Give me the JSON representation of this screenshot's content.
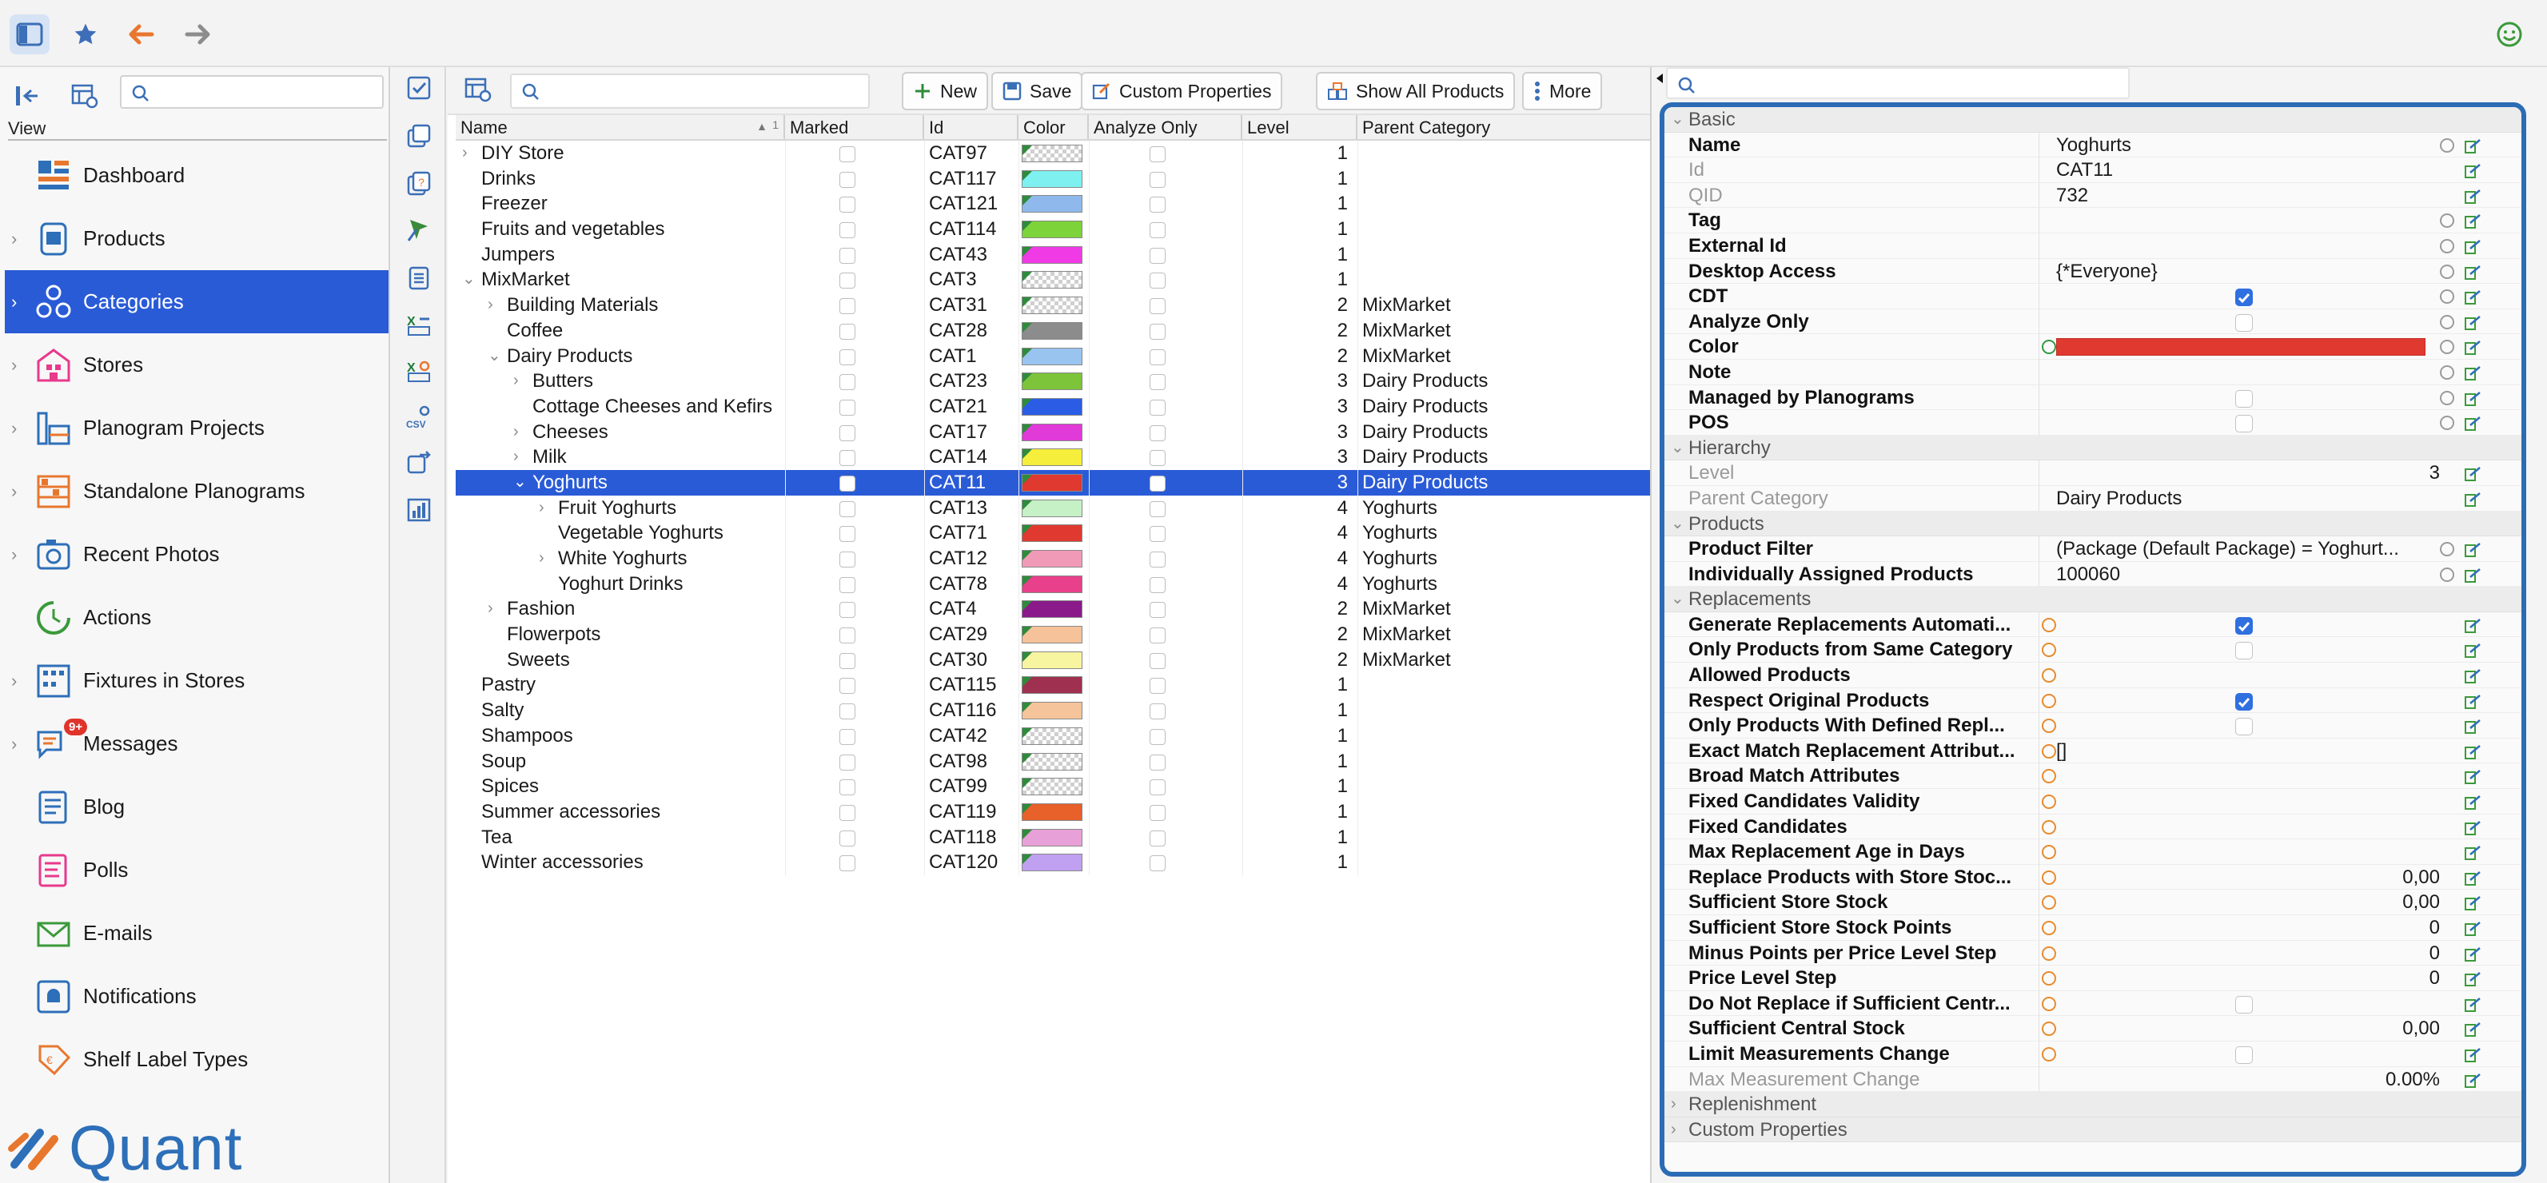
{
  "topbar": {
    "icons": [
      "sidebar-icon",
      "star-icon",
      "back-arrow-icon",
      "forward-arrow-icon",
      "smiley-icon"
    ]
  },
  "leftnav": {
    "search_placeholder": "",
    "view_label": "View",
    "items": [
      {
        "label": "Dashboard",
        "icon": "dashboard-icon",
        "chevron": false
      },
      {
        "label": "Products",
        "icon": "products-icon",
        "chevron": true
      },
      {
        "label": "Categories",
        "icon": "categories-icon",
        "chevron": true,
        "selected": true
      },
      {
        "label": "Stores",
        "icon": "stores-icon",
        "chevron": true
      },
      {
        "label": "Planogram Projects",
        "icon": "planogram-projects-icon",
        "chevron": true
      },
      {
        "label": "Standalone Planograms",
        "icon": "standalone-planograms-icon",
        "chevron": true
      },
      {
        "label": "Recent Photos",
        "icon": "camera-icon",
        "chevron": true
      },
      {
        "label": "Actions",
        "icon": "actions-icon",
        "chevron": false
      },
      {
        "label": "Fixtures in Stores",
        "icon": "fixtures-icon",
        "chevron": true
      },
      {
        "label": "Messages",
        "icon": "messages-icon",
        "chevron": true,
        "badge": "9+"
      },
      {
        "label": "Blog",
        "icon": "blog-icon",
        "chevron": false
      },
      {
        "label": "Polls",
        "icon": "polls-icon",
        "chevron": false
      },
      {
        "label": "E-mails",
        "icon": "email-icon",
        "chevron": false
      },
      {
        "label": "Notifications",
        "icon": "notifications-icon",
        "chevron": false
      },
      {
        "label": "Shelf Label Types",
        "icon": "shelf-label-icon",
        "chevron": false
      }
    ],
    "brand": "Quant"
  },
  "toolbar": {
    "search_placeholder": "",
    "new_label": "New",
    "save_label": "Save",
    "custom_properties_label": "Custom Properties",
    "show_all_products_label": "Show All Products",
    "more_label": "More"
  },
  "grid": {
    "columns": [
      "Name",
      "Marked",
      "Id",
      "Color",
      "Analyze Only",
      "Level",
      "Parent Category"
    ],
    "sort_indicator": "1",
    "rows": [
      {
        "name": "DIY Store",
        "indent": 0,
        "chev": "right",
        "id": "CAT97",
        "color": "checker",
        "level": "1",
        "parent": ""
      },
      {
        "name": "Drinks",
        "indent": 0,
        "chev": "",
        "id": "CAT117",
        "color": "#7ef0f0",
        "level": "1",
        "parent": ""
      },
      {
        "name": "Freezer",
        "indent": 0,
        "chev": "",
        "id": "CAT121",
        "color": "#8fb9ec",
        "level": "1",
        "parent": ""
      },
      {
        "name": "Fruits and vegetables",
        "indent": 0,
        "chev": "",
        "id": "CAT114",
        "color": "#7dd33a",
        "level": "1",
        "parent": ""
      },
      {
        "name": "Jumpers",
        "indent": 0,
        "chev": "",
        "id": "CAT43",
        "color": "#f03ae6",
        "level": "1",
        "parent": ""
      },
      {
        "name": "MixMarket",
        "indent": 0,
        "chev": "down",
        "id": "CAT3",
        "color": "checker",
        "level": "1",
        "parent": ""
      },
      {
        "name": "Building Materials",
        "indent": 1,
        "chev": "right",
        "id": "CAT31",
        "color": "checker",
        "level": "2",
        "parent": "MixMarket"
      },
      {
        "name": "Coffee",
        "indent": 1,
        "chev": "",
        "id": "CAT28",
        "color": "#8c8c8c",
        "level": "2",
        "parent": "MixMarket"
      },
      {
        "name": "Dairy Products",
        "indent": 1,
        "chev": "down",
        "id": "CAT1",
        "color": "#99c4f0",
        "level": "2",
        "parent": "MixMarket"
      },
      {
        "name": "Butters",
        "indent": 2,
        "chev": "right",
        "id": "CAT23",
        "color": "#7dc43a",
        "level": "3",
        "parent": "Dairy Products"
      },
      {
        "name": "Cottage Cheeses and Kefirs",
        "indent": 2,
        "chev": "",
        "id": "CAT21",
        "color": "#2a5ce6",
        "level": "3",
        "parent": "Dairy Products"
      },
      {
        "name": "Cheeses",
        "indent": 2,
        "chev": "right",
        "id": "CAT17",
        "color": "#e03ad8",
        "level": "3",
        "parent": "Dairy Products"
      },
      {
        "name": "Milk",
        "indent": 2,
        "chev": "right",
        "id": "CAT14",
        "color": "#f5ee3a",
        "level": "3",
        "parent": "Dairy Products"
      },
      {
        "name": "Yoghurts",
        "indent": 2,
        "chev": "down",
        "id": "CAT11",
        "color": "#e0392f",
        "level": "3",
        "parent": "Dairy Products",
        "selected": true
      },
      {
        "name": "Fruit Yoghurts",
        "indent": 3,
        "chev": "right",
        "id": "CAT13",
        "color": "#c6f0c6",
        "level": "4",
        "parent": "Yoghurts"
      },
      {
        "name": "Vegetable Yoghurts",
        "indent": 3,
        "chev": "",
        "id": "CAT71",
        "color": "#e03a30",
        "level": "4",
        "parent": "Yoghurts"
      },
      {
        "name": "White Yoghurts",
        "indent": 3,
        "chev": "right",
        "id": "CAT12",
        "color": "#f09ab8",
        "level": "4",
        "parent": "Yoghurts"
      },
      {
        "name": "Yoghurt Drinks",
        "indent": 3,
        "chev": "",
        "id": "CAT78",
        "color": "#e8408a",
        "level": "4",
        "parent": "Yoghurts"
      },
      {
        "name": "Fashion",
        "indent": 1,
        "chev": "right",
        "id": "CAT4",
        "color": "#8a1a8a",
        "level": "2",
        "parent": "MixMarket"
      },
      {
        "name": "Flowerpots",
        "indent": 1,
        "chev": "",
        "id": "CAT29",
        "color": "#f5c29a",
        "level": "2",
        "parent": "MixMarket"
      },
      {
        "name": "Sweets",
        "indent": 1,
        "chev": "",
        "id": "CAT30",
        "color": "#f8f5a0",
        "level": "2",
        "parent": "MixMarket"
      },
      {
        "name": "Pastry",
        "indent": 0,
        "chev": "",
        "id": "CAT115",
        "color": "#a03050",
        "level": "1",
        "parent": ""
      },
      {
        "name": "Salty",
        "indent": 0,
        "chev": "",
        "id": "CAT116",
        "color": "#f5c49a",
        "level": "1",
        "parent": ""
      },
      {
        "name": "Shampoos",
        "indent": 0,
        "chev": "",
        "id": "CAT42",
        "color": "checker",
        "level": "1",
        "parent": ""
      },
      {
        "name": "Soup",
        "indent": 0,
        "chev": "",
        "id": "CAT98",
        "color": "checker",
        "level": "1",
        "parent": ""
      },
      {
        "name": "Spices",
        "indent": 0,
        "chev": "",
        "id": "CAT99",
        "color": "checker",
        "level": "1",
        "parent": ""
      },
      {
        "name": "Summer accessories",
        "indent": 0,
        "chev": "",
        "id": "CAT119",
        "color": "#e8602a",
        "level": "1",
        "parent": ""
      },
      {
        "name": "Tea",
        "indent": 0,
        "chev": "",
        "id": "CAT118",
        "color": "#e8a0d8",
        "level": "1",
        "parent": ""
      },
      {
        "name": "Winter accessories",
        "indent": 0,
        "chev": "",
        "id": "CAT120",
        "color": "#c0a0f0",
        "level": "1",
        "parent": ""
      }
    ]
  },
  "properties": {
    "search_placeholder": "",
    "rows": [
      {
        "type": "section",
        "label": "Basic",
        "chev": "down"
      },
      {
        "type": "prop",
        "name": "Name",
        "value": "Yoghurts",
        "reset": true
      },
      {
        "type": "prop",
        "name": "Id",
        "value": "CAT11",
        "readonly": true
      },
      {
        "type": "prop",
        "name": "QID",
        "value": "732",
        "readonly": true
      },
      {
        "type": "prop",
        "name": "Tag",
        "value": "",
        "reset": true
      },
      {
        "type": "prop",
        "name": "External Id",
        "value": "",
        "reset": true
      },
      {
        "type": "prop",
        "name": "Desktop Access",
        "value": "{*Everyone}",
        "reset": true
      },
      {
        "type": "prop",
        "name": "CDT",
        "checkbox": "on",
        "reset": true
      },
      {
        "type": "prop",
        "name": "Analyze Only",
        "checkbox": "off",
        "reset": true
      },
      {
        "type": "prop",
        "name": "Color",
        "color": "#e0392f",
        "green": true,
        "reset": true
      },
      {
        "type": "prop",
        "name": "Note",
        "value": "",
        "reset": true
      },
      {
        "type": "prop",
        "name": "Managed by Planograms",
        "checkbox": "off",
        "reset": true
      },
      {
        "type": "prop",
        "name": "POS",
        "checkbox": "off",
        "reset": true
      },
      {
        "type": "section",
        "label": "Hierarchy",
        "chev": "down"
      },
      {
        "type": "prop",
        "name": "Level",
        "value": "3",
        "num": true,
        "readonly": true
      },
      {
        "type": "prop",
        "name": "Parent Category",
        "value": "Dairy Products",
        "readonly": true
      },
      {
        "type": "section",
        "label": "Products",
        "chev": "down"
      },
      {
        "type": "prop",
        "name": "Product Filter",
        "value": "(Package (Default Package) = Yoghurt...",
        "reset": true
      },
      {
        "type": "prop",
        "name": "Individually Assigned Products",
        "value": "100060",
        "reset": true
      },
      {
        "type": "section",
        "label": "Replacements",
        "chev": "down"
      },
      {
        "type": "prop",
        "name": "Generate Replacements Automati...",
        "checkbox": "on",
        "orange": true
      },
      {
        "type": "prop",
        "name": "Only Products from Same Category",
        "checkbox": "off",
        "orange": true
      },
      {
        "type": "prop",
        "name": "Allowed Products",
        "value": "",
        "orange": true
      },
      {
        "type": "prop",
        "name": "Respect Original Products",
        "checkbox": "on",
        "orange": true
      },
      {
        "type": "prop",
        "name": "Only Products With Defined Repl...",
        "checkbox": "off",
        "orange": true
      },
      {
        "type": "prop",
        "name": "Exact Match Replacement Attribut...",
        "value": "[]",
        "orange": true
      },
      {
        "type": "prop",
        "name": "Broad Match Attributes",
        "value": "",
        "orange": true
      },
      {
        "type": "prop",
        "name": "Fixed Candidates Validity",
        "value": "",
        "orange": true
      },
      {
        "type": "prop",
        "name": "Fixed Candidates",
        "value": "",
        "orange": true
      },
      {
        "type": "prop",
        "name": "Max Replacement Age in Days",
        "value": "",
        "orange": true
      },
      {
        "type": "prop",
        "name": "Replace Products with Store Stoc...",
        "value": "0,00",
        "num": true,
        "orange": true
      },
      {
        "type": "prop",
        "name": "Sufficient Store Stock",
        "value": "0,00",
        "num": true,
        "orange": true
      },
      {
        "type": "prop",
        "name": "Sufficient Store Stock Points",
        "value": "0",
        "num": true,
        "orange": true
      },
      {
        "type": "prop",
        "name": "Minus Points per Price Level Step",
        "value": "0",
        "num": true,
        "orange": true
      },
      {
        "type": "prop",
        "name": "Price Level Step",
        "value": "0",
        "num": true,
        "orange": true
      },
      {
        "type": "prop",
        "name": "Do Not Replace if Sufficient Centr...",
        "checkbox": "off",
        "orange": true
      },
      {
        "type": "prop",
        "name": "Sufficient Central Stock",
        "value": "0,00",
        "num": true,
        "orange": true
      },
      {
        "type": "prop",
        "name": "Limit Measurements Change",
        "checkbox": "off",
        "orange": true
      },
      {
        "type": "prop",
        "name": "Max Measurement Change",
        "value": "0.00%",
        "num": true,
        "readonly": true
      },
      {
        "type": "section",
        "label": "Replenishment",
        "chev": "right"
      },
      {
        "type": "section",
        "label": "Custom Properties",
        "chev": "right"
      }
    ]
  }
}
